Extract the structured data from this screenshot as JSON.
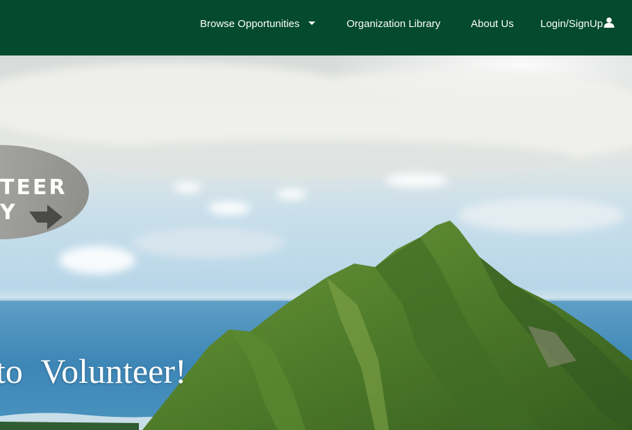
{
  "nav": {
    "browse_label": "Browse Opportunities",
    "library_label": "Organization Library",
    "about_label": "About Us",
    "login_label": "Login/SignUp"
  },
  "hero": {
    "logo_line1": "TEER",
    "logo_line2": "Y",
    "headline": "to Volunteer!"
  },
  "colors": {
    "nav_bg": "#034a2e",
    "nav_text": "#ffffff",
    "badge_bg": "#9a9a96"
  },
  "icons": {
    "browse_dropdown": "caret-down-icon",
    "login": "user-icon",
    "logo_arrow": "arrow-icon"
  }
}
